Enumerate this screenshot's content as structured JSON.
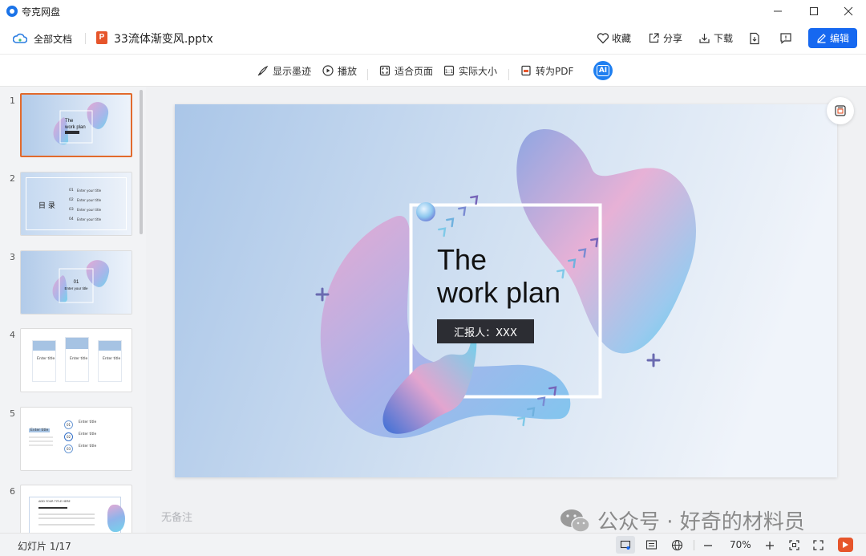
{
  "app": {
    "title": "夸克网盘"
  },
  "header": {
    "all_docs": "全部文档",
    "file_name": "33流体渐变风.pptx",
    "favorite": "收藏",
    "share": "分享",
    "download": "下载",
    "edit": "编辑"
  },
  "toolbar": {
    "show_ink": "显示墨迹",
    "play": "播放",
    "fit_page": "适合页面",
    "actual_size": "实际大小",
    "to_pdf": "转为PDF",
    "ai_label": "AI"
  },
  "slides": [
    {
      "num": "1",
      "title": "The",
      "subtitle": "work plan"
    },
    {
      "num": "2",
      "title": "目 录",
      "items": [
        {
          "idx": "01",
          "text": "Enter your title"
        },
        {
          "idx": "02",
          "text": "Enter your title"
        },
        {
          "idx": "03",
          "text": "Enter your title"
        },
        {
          "idx": "04",
          "text": "Enter your title"
        }
      ]
    },
    {
      "num": "3",
      "idx": "01",
      "text": "Enter your title"
    },
    {
      "num": "4",
      "cols": [
        "Enter title",
        "Enter title",
        "Enter title"
      ]
    },
    {
      "num": "5",
      "left": "Enter title",
      "items": [
        {
          "idx": "01",
          "text": "Enter title"
        },
        {
          "idx": "02",
          "text": "Enter title"
        },
        {
          "idx": "03",
          "text": "Enter title"
        }
      ]
    },
    {
      "num": "6",
      "text": "ADD YOUR TITLE HERE"
    }
  ],
  "main_slide": {
    "title_line1": "The",
    "title_line2": "work plan",
    "reporter": "汇报人：XXX"
  },
  "notes": {
    "placeholder": "无备注"
  },
  "watermark": {
    "text": "公众号 · 好奇的材料员"
  },
  "status": {
    "slide_counter": "幻灯片 1/17",
    "zoom": "70%"
  },
  "colors": {
    "accent": "#1668f0",
    "orange": "#e26a2c",
    "dark_box": "#2c2d33"
  }
}
